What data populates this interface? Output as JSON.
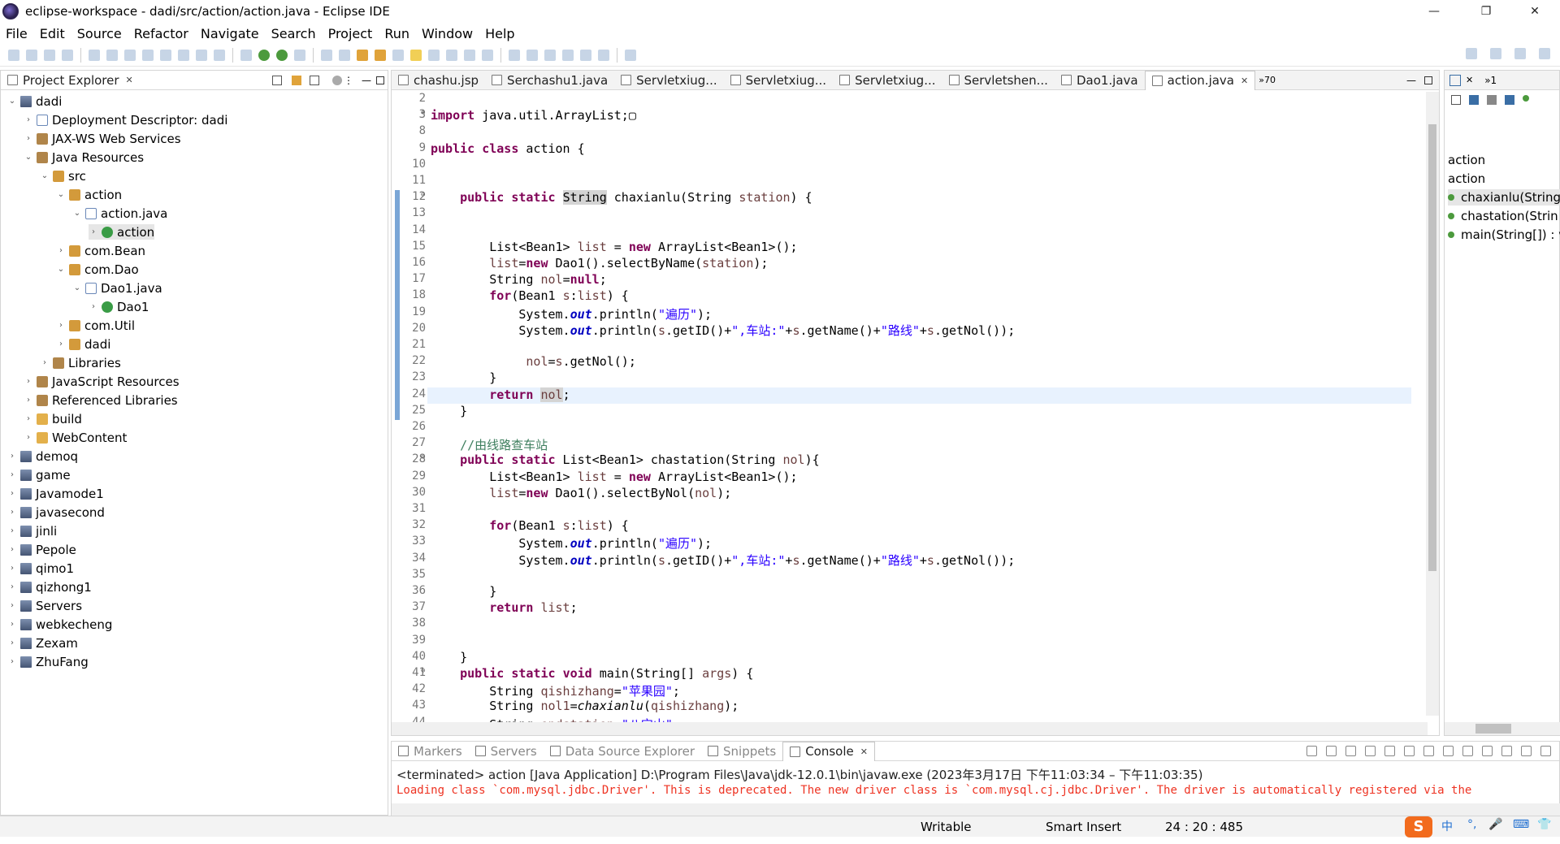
{
  "window": {
    "title": "eclipse-workspace - dadi/src/action/action.java - Eclipse IDE",
    "minimize": "—",
    "restore": "❐",
    "close": "✕"
  },
  "menu": [
    "File",
    "Edit",
    "Source",
    "Refactor",
    "Navigate",
    "Search",
    "Project",
    "Run",
    "Window",
    "Help"
  ],
  "project_explorer": {
    "title": "Project Explorer",
    "close": "✕",
    "items": [
      {
        "label": "dadi",
        "depth": 0,
        "arrow": "⌄",
        "icon": "proj"
      },
      {
        "label": "Deployment Descriptor: dadi",
        "depth": 1,
        "arrow": "›",
        "icon": "file"
      },
      {
        "label": "JAX-WS Web Services",
        "depth": 1,
        "arrow": "›",
        "icon": "lib"
      },
      {
        "label": "Java Resources",
        "depth": 1,
        "arrow": "⌄",
        "icon": "lib"
      },
      {
        "label": "src",
        "depth": 2,
        "arrow": "⌄",
        "icon": "pkg"
      },
      {
        "label": "action",
        "depth": 3,
        "arrow": "⌄",
        "icon": "pkg"
      },
      {
        "label": "action.java",
        "depth": 4,
        "arrow": "⌄",
        "icon": "file"
      },
      {
        "label": "action",
        "depth": 5,
        "arrow": "›",
        "icon": "cls",
        "selected": true
      },
      {
        "label": "com.Bean",
        "depth": 3,
        "arrow": "›",
        "icon": "pkg"
      },
      {
        "label": "com.Dao",
        "depth": 3,
        "arrow": "⌄",
        "icon": "pkg"
      },
      {
        "label": "Dao1.java",
        "depth": 4,
        "arrow": "⌄",
        "icon": "file"
      },
      {
        "label": "Dao1",
        "depth": 5,
        "arrow": "›",
        "icon": "cls"
      },
      {
        "label": "com.Util",
        "depth": 3,
        "arrow": "›",
        "icon": "pkg"
      },
      {
        "label": "dadi",
        "depth": 3,
        "arrow": "›",
        "icon": "pkg"
      },
      {
        "label": "Libraries",
        "depth": 2,
        "arrow": "›",
        "icon": "lib"
      },
      {
        "label": "JavaScript Resources",
        "depth": 1,
        "arrow": "›",
        "icon": "lib"
      },
      {
        "label": "Referenced Libraries",
        "depth": 1,
        "arrow": "›",
        "icon": "lib"
      },
      {
        "label": "build",
        "depth": 1,
        "arrow": "›",
        "icon": "folder"
      },
      {
        "label": "WebContent",
        "depth": 1,
        "arrow": "›",
        "icon": "folder"
      },
      {
        "label": "demoq",
        "depth": 0,
        "arrow": "›",
        "icon": "proj"
      },
      {
        "label": "game",
        "depth": 0,
        "arrow": "›",
        "icon": "proj"
      },
      {
        "label": "Javamode1",
        "depth": 0,
        "arrow": "›",
        "icon": "proj"
      },
      {
        "label": "javasecond",
        "depth": 0,
        "arrow": "›",
        "icon": "proj"
      },
      {
        "label": "jinli",
        "depth": 0,
        "arrow": "›",
        "icon": "proj"
      },
      {
        "label": "Pepole",
        "depth": 0,
        "arrow": "›",
        "icon": "proj"
      },
      {
        "label": "qimo1",
        "depth": 0,
        "arrow": "›",
        "icon": "proj"
      },
      {
        "label": "qizhong1",
        "depth": 0,
        "arrow": "›",
        "icon": "proj"
      },
      {
        "label": "Servers",
        "depth": 0,
        "arrow": "›",
        "icon": "proj"
      },
      {
        "label": "webkecheng",
        "depth": 0,
        "arrow": "›",
        "icon": "proj"
      },
      {
        "label": "Zexam",
        "depth": 0,
        "arrow": "›",
        "icon": "proj"
      },
      {
        "label": "ZhuFang",
        "depth": 0,
        "arrow": "›",
        "icon": "proj"
      }
    ]
  },
  "editor": {
    "tabs": [
      {
        "label": "chashu.jsp",
        "active": false
      },
      {
        "label": "Serchashu1.java",
        "active": false
      },
      {
        "label": "Servletxiug...",
        "active": false
      },
      {
        "label": "Servletxiug...",
        "active": false
      },
      {
        "label": "Servletxiug...",
        "active": false
      },
      {
        "label": "Servletshen...",
        "active": false
      },
      {
        "label": "Dao1.java",
        "active": false
      },
      {
        "label": "action.java",
        "active": true
      }
    ],
    "overflow": "»70",
    "lines": [
      {
        "n": "2",
        "fold": "",
        "html": ""
      },
      {
        "n": "3",
        "fold": "⊕",
        "html": "<span class='kw'>import</span> java.util.ArrayList;▢"
      },
      {
        "n": "8",
        "fold": "",
        "html": ""
      },
      {
        "n": "9",
        "fold": "",
        "html": "<span class='kw'>public</span> <span class='kw'>class</span> action {"
      },
      {
        "n": "10",
        "fold": "",
        "html": ""
      },
      {
        "n": "11",
        "fold": "",
        "html": ""
      },
      {
        "n": "12",
        "fold": "⊖",
        "html": "    <span class='kw'>public</span> <span class='kw'>static</span> <span style='background:#d4d4d4'>String</span> chaxianlu(String <span class='var'>station</span>) {"
      },
      {
        "n": "13",
        "fold": "",
        "html": ""
      },
      {
        "n": "14",
        "fold": "",
        "html": ""
      },
      {
        "n": "15",
        "fold": "",
        "html": "        List&lt;Bean1&gt; <span class='var'>list</span> = <span class='kw'>new</span> ArrayList&lt;Bean1&gt;();"
      },
      {
        "n": "16",
        "fold": "",
        "html": "        <span class='var'>list</span>=<span class='kw'>new</span> Dao1().selectByName(<span class='var'>station</span>);"
      },
      {
        "n": "17",
        "fold": "",
        "html": "        String <span class='var'>nol</span>=<span class='kw'>null</span>;"
      },
      {
        "n": "18",
        "fold": "",
        "html": "        <span class='kw'>for</span>(Bean1 <span class='var'>s</span>:<span class='var'>list</span>) {"
      },
      {
        "n": "19",
        "fold": "",
        "html": "            System.<span class='fld'>out</span>.println(<span class='str'>\"遍历\"</span>);"
      },
      {
        "n": "20",
        "fold": "",
        "html": "            System.<span class='fld'>out</span>.println(<span class='var'>s</span>.getID()+<span class='str'>\",车站:\"</span>+<span class='var'>s</span>.getName()+<span class='str'>\"路线\"</span>+<span class='var'>s</span>.getNol());"
      },
      {
        "n": "21",
        "fold": "",
        "html": ""
      },
      {
        "n": "22",
        "fold": "",
        "html": "             <span class='var'>nol</span>=<span class='var'>s</span>.getNol();"
      },
      {
        "n": "23",
        "fold": "",
        "html": "        }"
      },
      {
        "n": "24",
        "fold": "",
        "html": "        <span class='kw'>return</span> <span class='var' style='background:#d4d4d4'>nol</span>;",
        "current": true
      },
      {
        "n": "25",
        "fold": "",
        "html": "    }"
      },
      {
        "n": "26",
        "fold": "",
        "html": ""
      },
      {
        "n": "27",
        "fold": "",
        "html": "    <span class='cm'>//由线路查车站</span>"
      },
      {
        "n": "28",
        "fold": "⊖",
        "html": "    <span class='kw'>public</span> <span class='kw'>static</span> List&lt;Bean1&gt; chastation(String <span class='var'>nol</span>){"
      },
      {
        "n": "29",
        "fold": "",
        "html": "        List&lt;Bean1&gt; <span class='var'>list</span> = <span class='kw'>new</span> ArrayList&lt;Bean1&gt;();"
      },
      {
        "n": "30",
        "fold": "",
        "html": "        <span class='var'>list</span>=<span class='kw'>new</span> Dao1().selectByNol(<span class='var'>nol</span>);"
      },
      {
        "n": "31",
        "fold": "",
        "html": ""
      },
      {
        "n": "32",
        "fold": "",
        "html": "        <span class='kw'>for</span>(Bean1 <span class='var'>s</span>:<span class='var'>list</span>) {"
      },
      {
        "n": "33",
        "fold": "",
        "html": "            System.<span class='fld'>out</span>.println(<span class='str'>\"遍历\"</span>);"
      },
      {
        "n": "34",
        "fold": "",
        "html": "            System.<span class='fld'>out</span>.println(<span class='var'>s</span>.getID()+<span class='str'>\",车站:\"</span>+<span class='var'>s</span>.getName()+<span class='str'>\"路线\"</span>+<span class='var'>s</span>.getNol());"
      },
      {
        "n": "35",
        "fold": "",
        "html": ""
      },
      {
        "n": "36",
        "fold": "",
        "html": "        }"
      },
      {
        "n": "37",
        "fold": "",
        "html": "        <span class='kw'>return</span> <span class='var'>list</span>;"
      },
      {
        "n": "38",
        "fold": "",
        "html": ""
      },
      {
        "n": "39",
        "fold": "",
        "html": ""
      },
      {
        "n": "40",
        "fold": "",
        "html": "    }"
      },
      {
        "n": "41",
        "fold": "⊖",
        "html": "    <span class='kw'>public</span> <span class='kw'>static</span> <span class='kw'>void</span> main(String[] <span class='var'>args</span>) {"
      },
      {
        "n": "42",
        "fold": "",
        "html": "        String <span class='var'>qishizhang</span>=<span class='str'>\"苹果园\"</span>;"
      },
      {
        "n": "43",
        "fold": "",
        "html": "        String <span class='var'>nol1</span>=<span class='it'>chaxianlu</span>(<span class='var'>qishizhang</span>);"
      },
      {
        "n": "44",
        "fold": "",
        "html": "        String <span class='var'>endstation</span>=<span class='str'>\"八宝山\"</span>;"
      }
    ]
  },
  "outline": {
    "items": [
      {
        "label": "action",
        "kind": "pkg"
      },
      {
        "label": "action",
        "kind": "cls"
      },
      {
        "label": "chaxianlu(String",
        "kind": "method",
        "selected": true
      },
      {
        "label": "chastation(Strin",
        "kind": "method"
      },
      {
        "label": "main(String[]) : v",
        "kind": "method"
      }
    ]
  },
  "console": {
    "tabs": [
      "Markers",
      "Servers",
      "Data Source Explorer",
      "Snippets",
      "Console"
    ],
    "active_tab": "Console",
    "header": "<terminated> action [Java Application] D:\\Program Files\\Java\\jdk-12.0.1\\bin\\javaw.exe  (2023年3月17日 下午11:03:34 – 下午11:03:35)",
    "output": "Loading class `com.mysql.jdbc.Driver'. This is deprecated. The new driver class is `com.mysql.cj.jdbc.Driver'. The driver is automatically registered via the"
  },
  "status": {
    "writable": "Writable",
    "insert": "Smart Insert",
    "position": "24 : 20 : 485"
  },
  "ime": [
    "中",
    "°,",
    "🎤",
    "⌨",
    "👕"
  ]
}
